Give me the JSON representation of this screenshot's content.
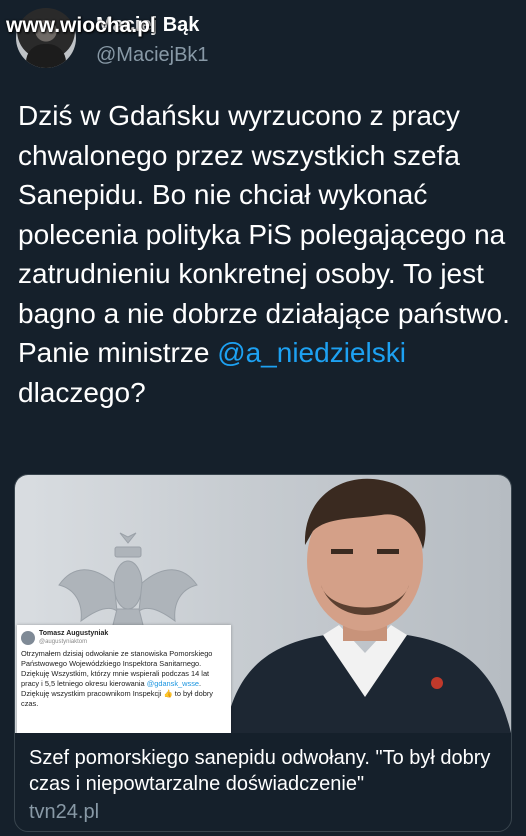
{
  "watermark": "www.wiocha.pl",
  "tweet": {
    "display_name": "Maciej Bąk",
    "handle": "@MaciejBk1",
    "text_before_mention": "Dziś w Gdańsku wyrzucono z pracy chwalonego przez wszystkich szefa Sanepidu. Bo nie chciał wykonać polecenia polityka PiS polegającego na zatrudnieniu konkretnej osoby. To jest bagno a nie dobrze działające państwo. Panie ministrze ",
    "mention": "@a_niedzielski",
    "text_after_mention": " dlaczego?",
    "mention_color": "#1da1f2"
  },
  "card": {
    "inset": {
      "name": "Tomasz Augustyniak",
      "handle": "@augustyniaktom",
      "text_1": "Otrzymałem dzisiaj odwołanie ze stanowiska Pomorskiego Państwowego Wojewódzkiego Inspektora Sanitarnego. Dziękuję Wszystkim, którzy mnie wspierali podczas 14 lat pracy i 5,5 letniego okresu kierowania ",
      "link": "@gdansk_wsse",
      "text_2": ". Dziękuję wszystkim pracownikom Inspekcji 👍 to był dobry czas."
    },
    "title": "Szef pomorskiego sanepidu odwołany. \"To był dobry czas i niepowtarzalne doświadczenie\"",
    "domain": "tvn24.pl"
  },
  "colors": {
    "background": "#15202b",
    "secondary_text": "#8899a6",
    "border": "#38444d"
  }
}
